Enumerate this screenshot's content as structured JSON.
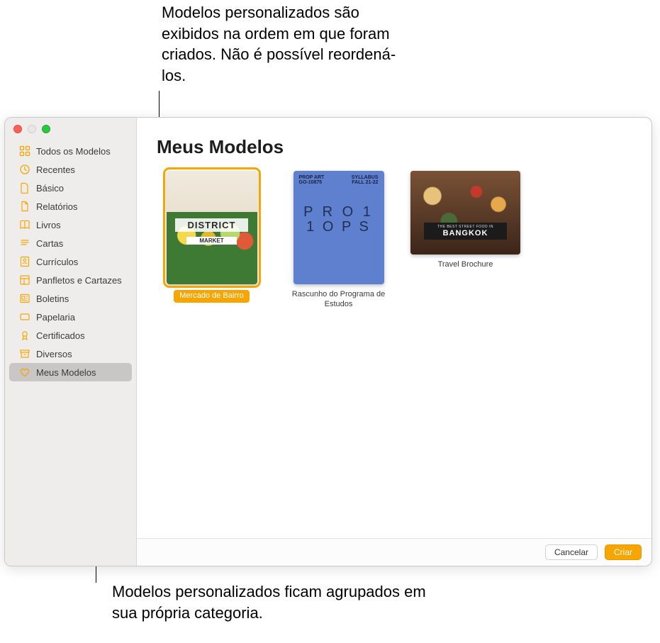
{
  "callouts": {
    "top": "Modelos personalizados são exibidos na ordem em que foram criados. Não é possível reordená-los.",
    "bottom": "Modelos personalizados ficam agrupados em sua própria categoria."
  },
  "sidebar": {
    "items": [
      {
        "label": "Todos os Modelos",
        "icon": "grid"
      },
      {
        "label": "Recentes",
        "icon": "clock"
      },
      {
        "label": "Básico",
        "icon": "doc"
      },
      {
        "label": "Relatórios",
        "icon": "docfold"
      },
      {
        "label": "Livros",
        "icon": "book"
      },
      {
        "label": "Cartas",
        "icon": "lines"
      },
      {
        "label": "Currículos",
        "icon": "person"
      },
      {
        "label": "Panfletos e Cartazes",
        "icon": "layout"
      },
      {
        "label": "Boletins",
        "icon": "news"
      },
      {
        "label": "Papelaria",
        "icon": "card"
      },
      {
        "label": "Certificados",
        "icon": "ribbon"
      },
      {
        "label": "Diversos",
        "icon": "archive"
      },
      {
        "label": "Meus Modelos",
        "icon": "heart",
        "selected": true
      }
    ]
  },
  "main": {
    "title": "Meus Modelos",
    "templates": [
      {
        "label": "Mercado de Bairro",
        "selected": true,
        "thumb": {
          "title": "DISTRICT",
          "subtitle": "MARKET"
        }
      },
      {
        "label": "Rascunho do Programa de Estudos",
        "thumb": {
          "left": "PROP ART\nGO-10875",
          "right": "SYLLABUS\nFALL 21-22",
          "word_l1": "P R O 1",
          "word_l2": "1 O P S"
        }
      },
      {
        "label": "Travel Brochure",
        "landscape": true,
        "thumb": {
          "small": "THE BEST STREET FOOD IN",
          "big": "BANGKOK"
        }
      }
    ]
  },
  "footer": {
    "cancel": "Cancelar",
    "create": "Criar"
  }
}
